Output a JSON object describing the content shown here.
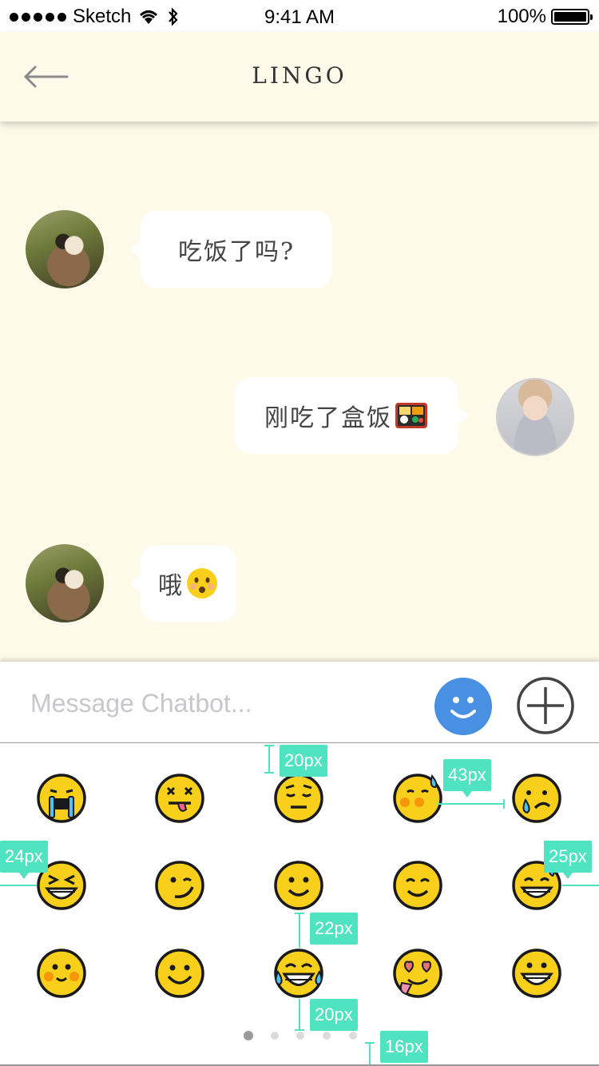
{
  "status_bar": {
    "carrier": "Sketch",
    "time": "9:41 AM",
    "battery": "100%"
  },
  "navbar": {
    "title": "LINGO"
  },
  "messages": [
    {
      "from": "bot",
      "text": "吃饭了吗?"
    },
    {
      "from": "user",
      "text": "刚吃了盒饭"
    },
    {
      "from": "bot",
      "text": "哦"
    }
  ],
  "input": {
    "placeholder": "Message Chatbot..."
  },
  "emoji_panel": {
    "rows": [
      [
        "crying-face-icon",
        "dizzy-face-icon",
        "relieved-face-icon",
        "sweat-smile-face-icon",
        "sad-tear-face-icon"
      ],
      [
        "grin-squint-face-icon",
        "smirk-face-icon",
        "slight-smile-face-icon",
        "blush-smile-face-icon",
        "grin-sweat-face-icon"
      ],
      [
        "blushing-face-icon",
        "smile-face-icon",
        "tears-of-joy-face-icon",
        "heart-eyes-face-icon",
        "grinning-face-icon"
      ]
    ],
    "page_count": 5,
    "current_page": 1
  },
  "annotations": [
    "20px",
    "43px",
    "24px",
    "25px",
    "22px",
    "20px",
    "16px"
  ],
  "colors": {
    "background": "#FFF9EA",
    "accent": "#4A90E2",
    "annotation": "#50E3C2",
    "emoji_yellow": "#F8D01C"
  }
}
